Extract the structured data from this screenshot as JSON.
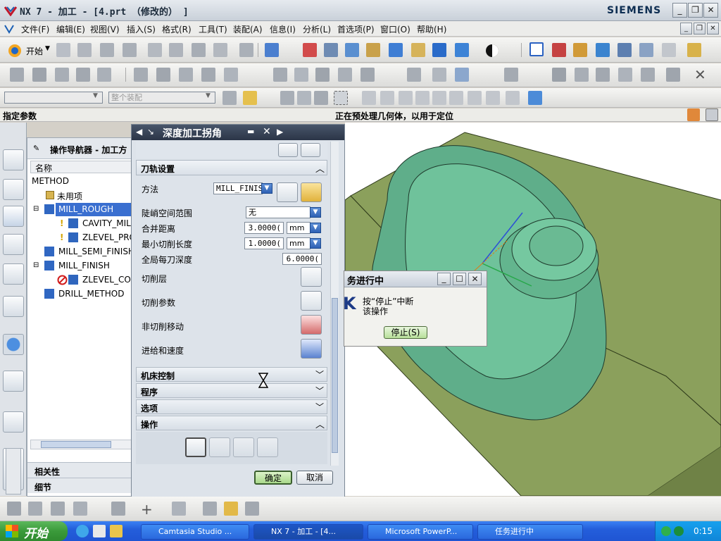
{
  "window": {
    "title": "NX 7 - 加工 - [4.prt （修改的） ]",
    "brand": "SIEMENS"
  },
  "menubar": [
    "文件(F)",
    "编辑(E)",
    "视图(V)",
    "插入(S)",
    "格式(R)",
    "工具(T)",
    "装配(A)",
    "信息(I)",
    "分析(L)",
    "首选项(P)",
    "窗口(O)",
    "帮助(H)"
  ],
  "toolbar": {
    "start_label": "开始"
  },
  "selection_bar": {
    "filter_value": "",
    "scope_value": "整个装配"
  },
  "status": {
    "left": "指定参数",
    "center": "正在预处理几何体，以用于定位"
  },
  "navigator": {
    "title": "操作导航器 - 加工方",
    "column_header": "名称",
    "rows": [
      {
        "label": "METHOD",
        "indent": 0
      },
      {
        "label": "未用项",
        "indent": 1
      },
      {
        "label": "MILL_ROUGH",
        "indent": 1,
        "selected": true
      },
      {
        "label": "CAVITY_MIL",
        "indent": 2
      },
      {
        "label": "ZLEVEL_PRO",
        "indent": 2
      },
      {
        "label": "MILL_SEMI_FINISH",
        "indent": 1
      },
      {
        "label": "MILL_FINISH",
        "indent": 1
      },
      {
        "label": "ZLEVEL_COR",
        "indent": 2
      },
      {
        "label": "DRILL_METHOD",
        "indent": 1
      }
    ],
    "panels": [
      "相关性",
      "细节"
    ]
  },
  "dialog": {
    "title": "深度加工拐角",
    "section_path": "刀轨设置",
    "method_label": "方法",
    "method_value": "MILL_FINIS",
    "steep_label": "陡峭空间范围",
    "steep_value": "无",
    "merge_label": "合并距离",
    "merge_value": "3.0000(",
    "merge_unit": "mm",
    "mincut_label": "最小切削长度",
    "mincut_value": "1.0000(",
    "mincut_unit": "mm",
    "depth_label": "全局每刀深度",
    "depth_value": "6.0000(",
    "cutlevel_label": "切削层",
    "cutparam_label": "切削参数",
    "noncut_label": "非切削移动",
    "feed_label": "进给和速度",
    "section_machine": "机床控制",
    "section_program": "程序",
    "section_options": "选项",
    "section_action": "操作",
    "ok_label": "确定",
    "cancel_label": "取消"
  },
  "progress": {
    "title": "务进行中",
    "message_line1": "按“停止”中断",
    "message_line2": "该操作",
    "stop_label": "停止(S)"
  },
  "taskbar": {
    "start": "开始",
    "tasks": [
      "Camtasia Studio ...",
      "NX 7 - 加工 - [4...",
      "Microsoft PowerP...",
      "任务进行中"
    ],
    "clock": "0:15"
  },
  "colors": {
    "part_green": "#5fae8a",
    "block_olive": "#7f9455",
    "accent_blue": "#2f61b4",
    "taskbar_blue": "#245edb"
  }
}
